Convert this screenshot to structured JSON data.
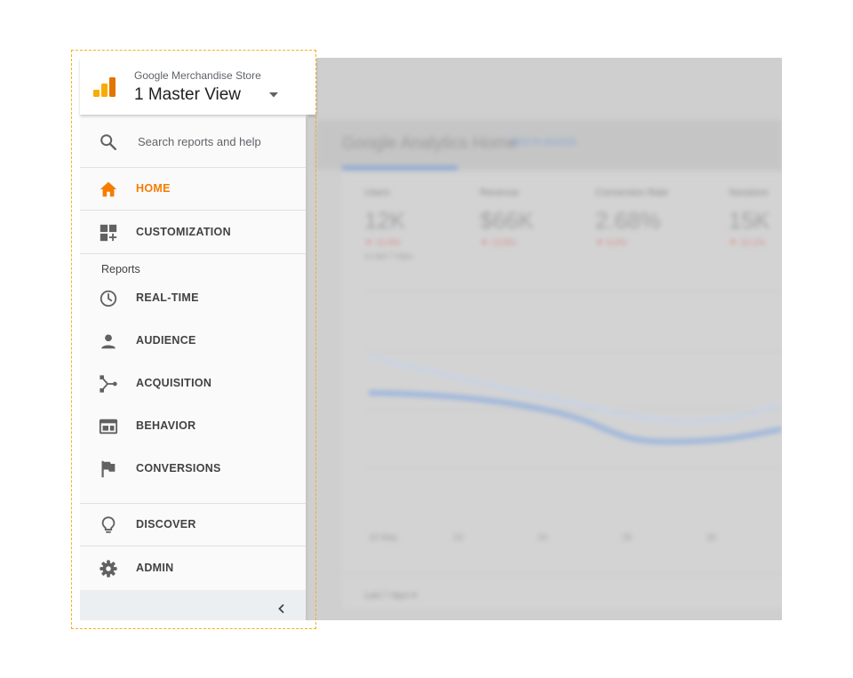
{
  "background": {
    "page_title": "Google Analytics Home",
    "title_badge": "BEETA BADGE",
    "metrics": [
      {
        "label": "Users",
        "value": "12K",
        "delta": "▼ 10.9%",
        "sub": "vs last 7 days"
      },
      {
        "label": "Revenue",
        "value": "$66K",
        "delta": "▼ 13.8%",
        "sub": ""
      },
      {
        "label": "Conversion Rate",
        "value": "2.68%",
        "delta": "▼ 8.0%",
        "sub": ""
      },
      {
        "label": "Sessions",
        "value": "15K",
        "delta": "▼ 10.1%",
        "sub": ""
      }
    ],
    "x_ticks": [
      "22 May",
      "23",
      "24",
      "25",
      "26"
    ],
    "footer_text": "Last 7 days ▾"
  },
  "sidebar": {
    "account_name": "Google Merchandise Store",
    "view_name": "1 Master View",
    "search_placeholder": "Search reports and help",
    "top_items": [
      {
        "label": "HOME",
        "icon": "home-icon",
        "active": true
      },
      {
        "label": "CUSTOMIZATION",
        "icon": "customization-icon",
        "active": false
      }
    ],
    "reports_section_label": "Reports",
    "report_items": [
      {
        "label": "REAL-TIME",
        "icon": "clock-icon"
      },
      {
        "label": "AUDIENCE",
        "icon": "person-icon"
      },
      {
        "label": "ACQUISITION",
        "icon": "acquisition-icon"
      },
      {
        "label": "BEHAVIOR",
        "icon": "behavior-icon"
      },
      {
        "label": "CONVERSIONS",
        "icon": "flag-icon"
      }
    ],
    "bottom_items": [
      {
        "label": "DISCOVER",
        "icon": "lightbulb-icon"
      },
      {
        "label": "ADMIN",
        "icon": "gear-icon"
      }
    ],
    "collapse_icon": "chevron-left-icon"
  },
  "colors": {
    "accent_active": "#f57c00",
    "highlight_frame": "#f2b21b",
    "logo_dark": "#e37400",
    "logo_light": "#f9ab00"
  }
}
